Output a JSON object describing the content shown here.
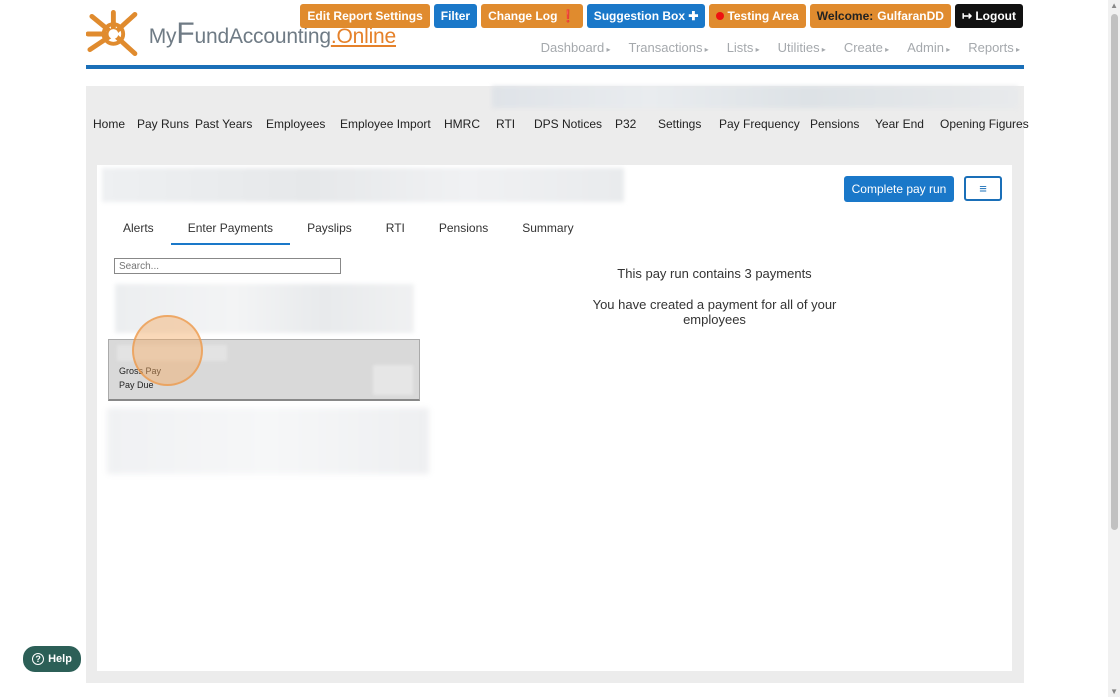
{
  "logo": {
    "my": "My",
    "f": "F",
    "fund": "und",
    "accounting": "Accounting",
    "online": ".Online"
  },
  "top_buttons": {
    "edit_report": "Edit Report Settings",
    "filter": "Filter",
    "change_log": "Change Log ❗",
    "suggestion": "Suggestion Box ✚",
    "testing": "Testing Area",
    "welcome_label": "Welcome:",
    "welcome_user": "GulfaranDD",
    "logout": "↦ Logout"
  },
  "main_nav": [
    "Dashboard",
    "Transactions",
    "Lists",
    "Utilities",
    "Create",
    "Admin",
    "Reports"
  ],
  "sub_nav": [
    "Home",
    "Pay Runs",
    "Past Years",
    "Employees",
    "Employee Import",
    "HMRC",
    "RTI",
    "DPS Notices",
    "P32",
    "Settings",
    "Pay Frequency",
    "Pensions",
    "Year End",
    "Opening Figures"
  ],
  "actions": {
    "complete": "Complete pay run",
    "menu_icon": "≡"
  },
  "tabs": [
    "Alerts",
    "Enter Payments",
    "Payslips",
    "RTI",
    "Pensions",
    "Summary"
  ],
  "active_tab": "Enter Payments",
  "search": {
    "placeholder": "Search..."
  },
  "employee_card": {
    "gross": "Gross Pay",
    "due": "Pay Due"
  },
  "info": {
    "count": "This pay run contains 3 payments",
    "created": "You have created a payment for all of your employees"
  },
  "help": {
    "label": "Help",
    "icon": "?"
  },
  "colors": {
    "accent_blue": "#1a78c9",
    "orange": "#e08b2e",
    "brand_blue": "#1a6fb8"
  }
}
